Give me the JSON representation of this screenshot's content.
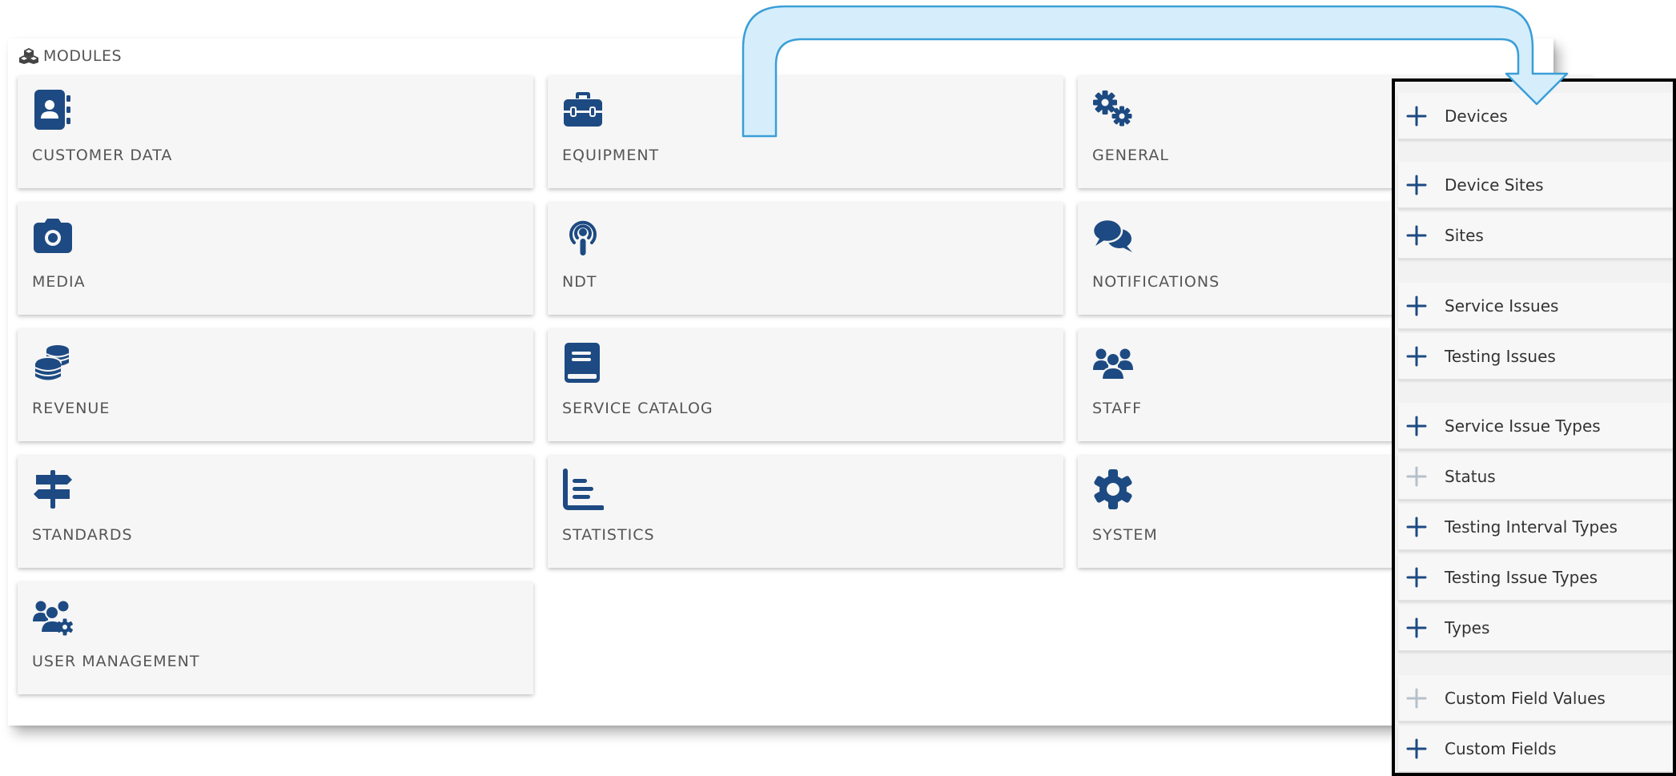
{
  "panel": {
    "title": "MODULES",
    "icon": "cubes-icon"
  },
  "tiles": [
    {
      "label": "CUSTOMER DATA",
      "icon": "address-book-icon"
    },
    {
      "label": "EQUIPMENT",
      "icon": "toolbox-icon"
    },
    {
      "label": "GENERAL",
      "icon": "cogs-icon"
    },
    {
      "label": "MEDIA",
      "icon": "camera-icon"
    },
    {
      "label": "NDT",
      "icon": "podcast-icon"
    },
    {
      "label": "NOTIFICATIONS",
      "icon": "comments-icon"
    },
    {
      "label": "REVENUE",
      "icon": "coins-icon"
    },
    {
      "label": "SERVICE CATALOG",
      "icon": "book-icon"
    },
    {
      "label": "STAFF",
      "icon": "users-icon"
    },
    {
      "label": "STANDARDS",
      "icon": "signs-icon"
    },
    {
      "label": "STATISTICS",
      "icon": "chart-bar-icon"
    },
    {
      "label": "SYSTEM",
      "icon": "gear-icon"
    },
    {
      "label": "USER MANAGEMENT",
      "icon": "users-cog-icon"
    }
  ],
  "menu": {
    "items": [
      {
        "label": "Devices",
        "enabled": true
      },
      {
        "label": "Device Sites",
        "enabled": true
      },
      {
        "label": "Sites",
        "enabled": true
      },
      {
        "label": "Service Issues",
        "enabled": true
      },
      {
        "label": "Testing Issues",
        "enabled": true
      },
      {
        "label": "Service Issue Types",
        "enabled": true
      },
      {
        "label": "Status",
        "enabled": false
      },
      {
        "label": "Testing Interval Types",
        "enabled": true
      },
      {
        "label": "Testing Issue Types",
        "enabled": true
      },
      {
        "label": "Types",
        "enabled": true
      },
      {
        "label": "Custom Field Values",
        "enabled": false
      },
      {
        "label": "Custom Fields",
        "enabled": true
      }
    ]
  },
  "colors": {
    "icon": "#1d4a82",
    "disabled_plus": "#b6c0cc",
    "arrow_fill": "#d6eefb",
    "arrow_stroke": "#3a9ed8",
    "menu_border": "#000000"
  }
}
